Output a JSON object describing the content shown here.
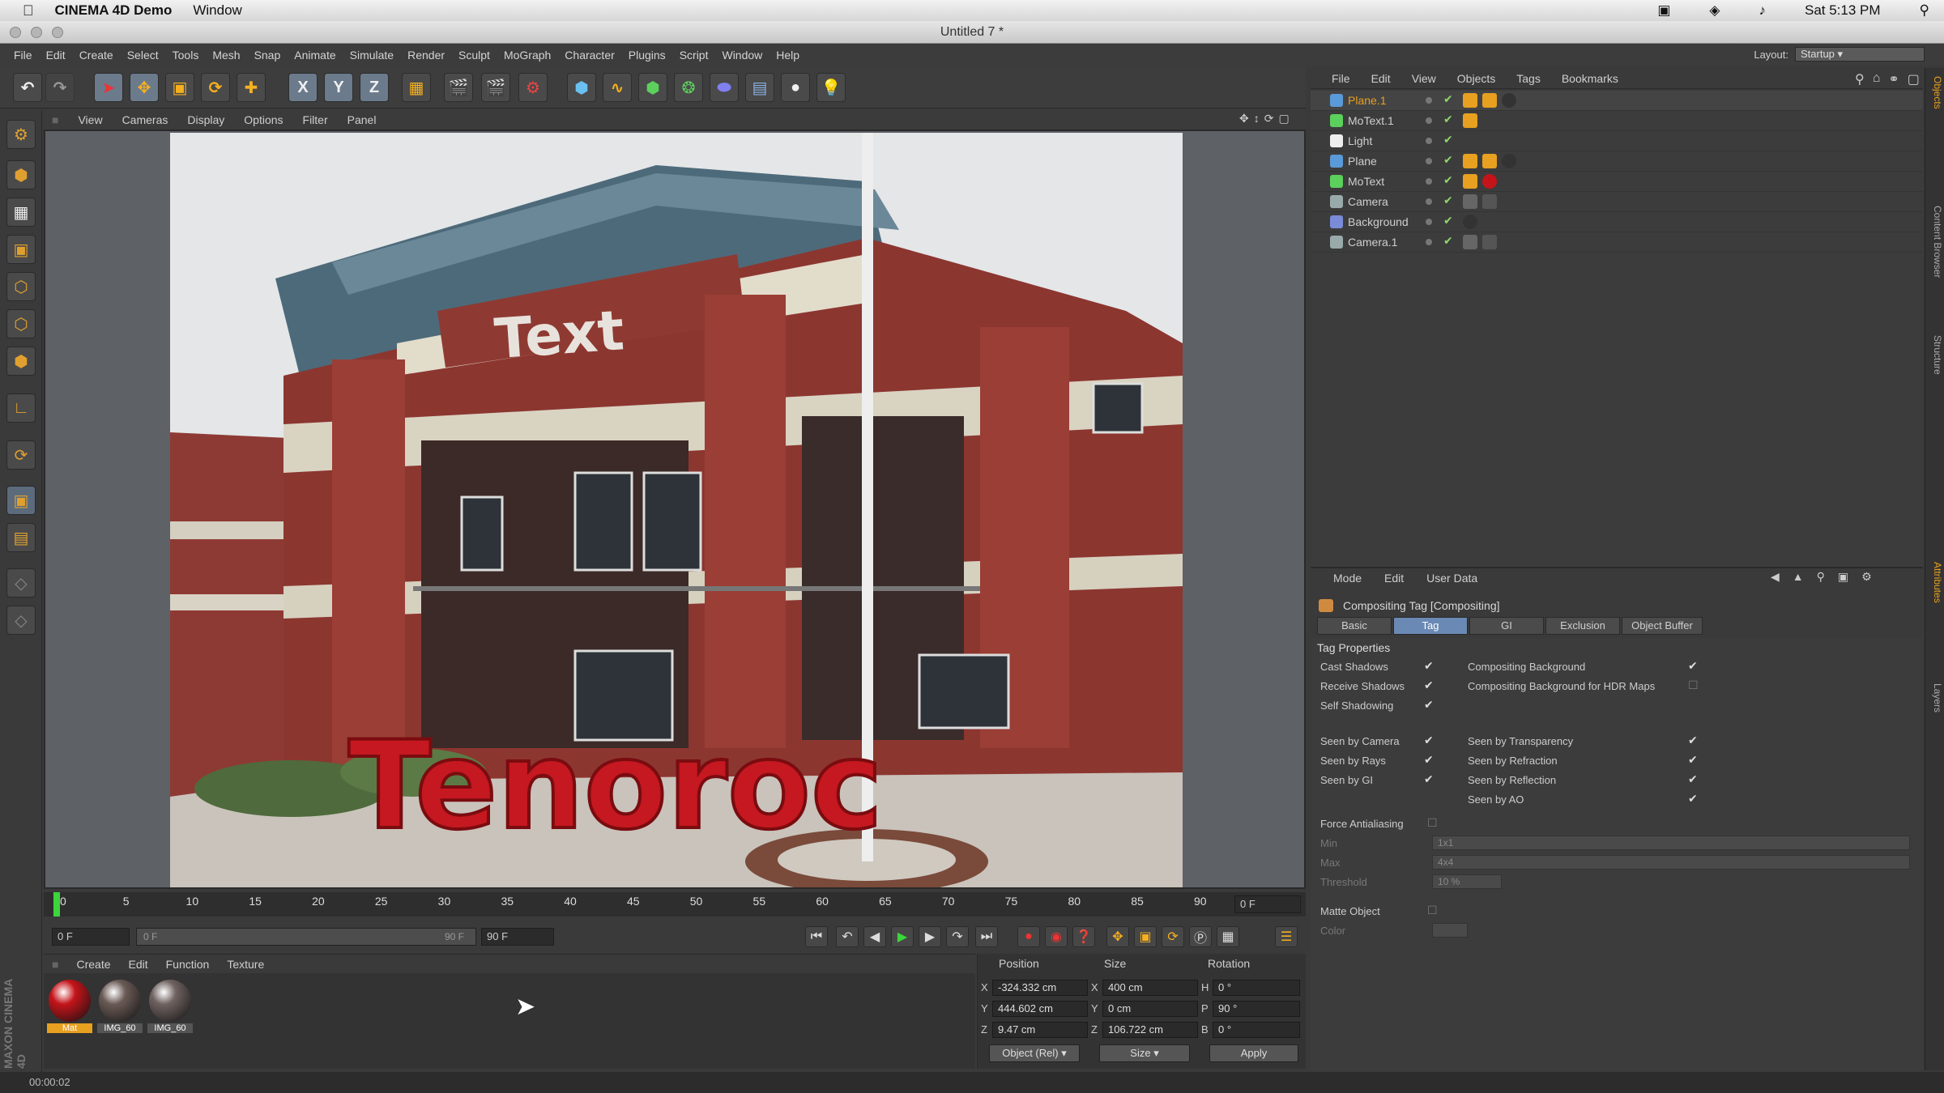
{
  "mac_menubar": {
    "app": "CINEMA 4D Demo",
    "window_menu": "Window",
    "clock": "Sat 5:13 PM"
  },
  "window_title": "Untitled 7 *",
  "app_menu": [
    "File",
    "Edit",
    "Create",
    "Select",
    "Tools",
    "Mesh",
    "Snap",
    "Animate",
    "Simulate",
    "Render",
    "Sculpt",
    "MoGraph",
    "Character",
    "Plugins",
    "Script",
    "Window",
    "Help"
  ],
  "layout": {
    "label": "Layout:",
    "value": "Startup"
  },
  "toolbar": {
    "x_axis": "X",
    "y_axis": "Y",
    "z_axis": "Z"
  },
  "viewport_menu": [
    "View",
    "Cameras",
    "Display",
    "Options",
    "Filter",
    "Panel"
  ],
  "scene": {
    "sign_text": "Text",
    "motext": "Tenoroc"
  },
  "timeline": {
    "ticks": [
      "0",
      "5",
      "10",
      "15",
      "20",
      "25",
      "30",
      "35",
      "40",
      "45",
      "50",
      "55",
      "60",
      "65",
      "70",
      "75",
      "80",
      "85",
      "90"
    ],
    "end_frame": "0 F"
  },
  "transport": {
    "current_frame": "0 F",
    "range_start": "0 F",
    "range_end": "90 F",
    "max_frame": "90 F"
  },
  "material_menu": [
    "Create",
    "Edit",
    "Function",
    "Texture"
  ],
  "materials": [
    {
      "name": "Mat",
      "color": "#c4141a"
    },
    {
      "name": "IMG_60",
      "color": "#6a5a55"
    },
    {
      "name": "IMG_60",
      "color": "#6f6260"
    }
  ],
  "coordinates": {
    "headers": {
      "position": "Position",
      "size": "Size",
      "rotation": "Rotation"
    },
    "rows": [
      {
        "axis": "X",
        "pos": "-324.332 cm",
        "size_axis": "X",
        "size": "400 cm",
        "rot_axis": "H",
        "rot": "0 °"
      },
      {
        "axis": "Y",
        "pos": "444.602 cm",
        "size_axis": "Y",
        "size": "0 cm",
        "rot_axis": "P",
        "rot": "90 °"
      },
      {
        "axis": "Z",
        "pos": "9.47 cm",
        "size_axis": "Z",
        "size": "106.722 cm",
        "rot_axis": "B",
        "rot": "0 °"
      }
    ],
    "mode": "Object (Rel)",
    "size_mode": "Size",
    "apply": "Apply"
  },
  "status": {
    "time": "00:00:02",
    "brand": "MAXON CINEMA 4D"
  },
  "object_menu": [
    "File",
    "Edit",
    "View",
    "Objects",
    "Tags",
    "Bookmarks"
  ],
  "objects": [
    {
      "name": "Plane.1",
      "color": "#e8a020",
      "selected": true,
      "icon": "plane-icon"
    },
    {
      "name": "MoText.1",
      "color": "#cfcfcf",
      "icon": "motext-icon"
    },
    {
      "name": "Light",
      "color": "#cfcfcf",
      "icon": "light-icon"
    },
    {
      "name": "Plane",
      "color": "#cfcfcf",
      "icon": "plane-icon"
    },
    {
      "name": "MoText",
      "color": "#cfcfcf",
      "icon": "motext-icon"
    },
    {
      "name": "Camera",
      "color": "#cfcfcf",
      "icon": "camera-icon"
    },
    {
      "name": "Background",
      "color": "#cfcfcf",
      "icon": "background-icon"
    },
    {
      "name": "Camera.1",
      "color": "#cfcfcf",
      "icon": "camera-icon"
    }
  ],
  "attr_menu": [
    "Mode",
    "Edit",
    "User Data"
  ],
  "attr_title": "Compositing Tag [Compositing]",
  "attr_tabs": [
    "Basic",
    "Tag",
    "GI",
    "Exclusion",
    "Object Buffer"
  ],
  "tag_properties": {
    "heading": "Tag Properties",
    "left": [
      {
        "label": "Cast Shadows",
        "checked": true
      },
      {
        "label": "Receive Shadows",
        "checked": true
      },
      {
        "label": "Self Shadowing",
        "checked": true
      },
      {
        "label": "Seen by Camera",
        "checked": true
      },
      {
        "label": "Seen by Rays",
        "checked": true
      },
      {
        "label": "Seen by GI",
        "checked": true
      }
    ],
    "right": [
      {
        "label": "Compositing Background",
        "checked": true
      },
      {
        "label": "Compositing Background for HDR Maps",
        "checked": false
      },
      {
        "label": "Seen by Transparency",
        "checked": true
      },
      {
        "label": "Seen by Refraction",
        "checked": true
      },
      {
        "label": "Seen by Reflection",
        "checked": true
      },
      {
        "label": "Seen by AO",
        "checked": true
      }
    ],
    "force_aa": "Force Antialiasing",
    "min": {
      "label": "Min",
      "value": "1x1"
    },
    "max": {
      "label": "Max",
      "value": "4x4"
    },
    "threshold": {
      "label": "Threshold",
      "value": "10 %"
    },
    "matte": "Matte Object",
    "color": "Color"
  },
  "right_tabs": [
    "Objects",
    "Content Browser",
    "Structure",
    "Attributes",
    "Layers"
  ]
}
